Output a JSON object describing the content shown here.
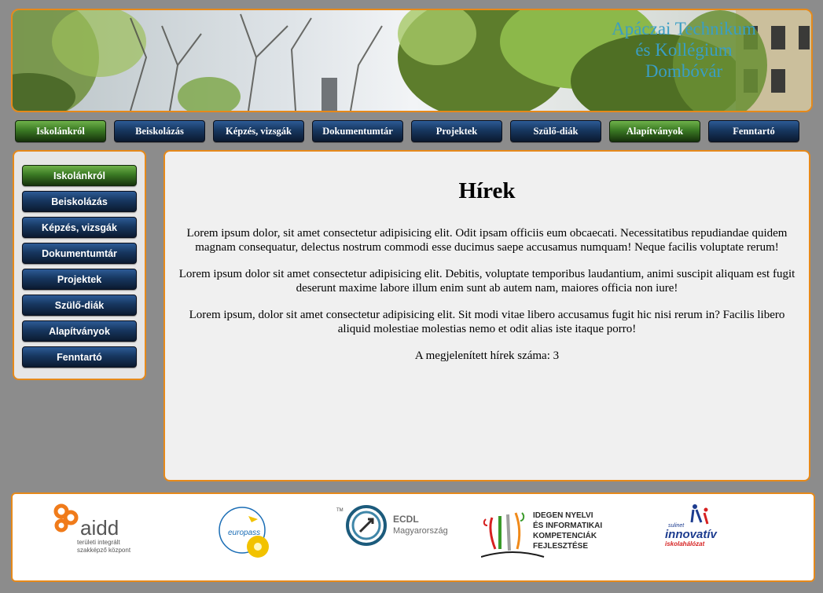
{
  "header": {
    "school_name_lines": [
      "Apáczai Technikum",
      "és Kollégium",
      "Dombóvár"
    ]
  },
  "top_nav": [
    {
      "label": "Iskolánkról",
      "active": true
    },
    {
      "label": "Beiskolázás",
      "active": false
    },
    {
      "label": "Képzés, vizsgák",
      "active": false
    },
    {
      "label": "Dokumentumtár",
      "active": false
    },
    {
      "label": "Projektek",
      "active": false
    },
    {
      "label": "Szülő-diák",
      "active": false
    },
    {
      "label": "Alapítványok",
      "active": true
    },
    {
      "label": "Fenntartó",
      "active": false
    }
  ],
  "side_nav": [
    {
      "label": "Iskolánkról",
      "active": true
    },
    {
      "label": "Beiskolázás",
      "active": false
    },
    {
      "label": "Képzés, vizsgák",
      "active": false
    },
    {
      "label": "Dokumentumtár",
      "active": false
    },
    {
      "label": "Projektek",
      "active": false
    },
    {
      "label": "Szülő-diák",
      "active": false
    },
    {
      "label": "Alapítványok",
      "active": false
    },
    {
      "label": "Fenntartó",
      "active": false
    }
  ],
  "main": {
    "title": "Hírek",
    "paragraphs": [
      "Lorem ipsum dolor, sit amet consectetur adipisicing elit. Odit ipsam officiis eum obcaecati. Necessitatibus repudiandae quidem magnam consequatur, delectus nostrum commodi esse ducimus saepe accusamus numquam! Neque facilis voluptate rerum!",
      "Lorem ipsum dolor sit amet consectetur adipisicing elit. Debitis, voluptate temporibus laudantium, animi suscipit aliquam est fugit deserunt maxime labore illum enim sunt ab autem nam, maiores officia non iure!",
      "Lorem ipsum, dolor sit amet consectetur adipisicing elit. Sit modi vitae libero accusamus fugit hic nisi rerum in? Facilis libero aliquid molestiae molestias nemo et odit alias iste itaque porro!"
    ],
    "count_text": "A megjelenített hírek száma: 3"
  },
  "footer": {
    "aidd": {
      "name": "aidd",
      "sub1": "területi integrált",
      "sub2": "szakképző központ"
    },
    "europass": {
      "text": "europass"
    },
    "ecdl": {
      "tm": "TM",
      "line1": "ECDL",
      "line2": "Magyarország"
    },
    "idegen": {
      "lines": [
        "IDEGEN NYELVI",
        "ÉS INFORMATIKAI",
        "KOMPETENCIÁK",
        "FEJLESZTÉSE"
      ]
    },
    "innovativ": {
      "top": "sulinet",
      "main": "innovatív",
      "sub": "iskolahálózat"
    }
  },
  "colors": {
    "page_bg": "#8c8c8c",
    "panel_border": "#e6891a",
    "panel_bg": "#f0f0f0",
    "button_blue": "#173760",
    "button_green": "#3b7a24",
    "school_name": "#3a9ec4"
  }
}
